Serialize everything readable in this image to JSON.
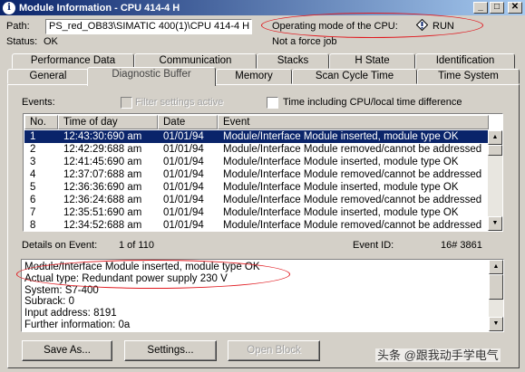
{
  "window": {
    "title": "Module Information - CPU 414-4 H",
    "minimize": "_",
    "maximize": "□",
    "close": "✕"
  },
  "header": {
    "path_label": "Path:",
    "path_value": "PS_red_OB83\\SIMATIC 400(1)\\CPU 414-4 H",
    "opmode_label": "Operating mode of the  CPU:",
    "opmode_value": "RUN",
    "status_label": "Status:",
    "status_value": "OK",
    "force_text": "Not a force job"
  },
  "tabs_row1": [
    "Performance Data",
    "Communication",
    "Stacks",
    "H State",
    "Identification"
  ],
  "tabs_row2": [
    "General",
    "Diagnostic Buffer",
    "Memory",
    "Scan Cycle Time",
    "Time System"
  ],
  "active_tab": "Diagnostic Buffer",
  "events": {
    "label": "Events:",
    "filter_label": "Filter settings active",
    "time_label": "Time including CPU/local time difference",
    "columns": [
      "No.",
      "Time of day",
      "Date",
      "Event"
    ],
    "rows": [
      {
        "no": "1",
        "time": "12:43:30:690 am",
        "date": "01/01/94",
        "event": "Module/Interface Module  inserted, module type OK"
      },
      {
        "no": "2",
        "time": "12:42:29:688 am",
        "date": "01/01/94",
        "event": "Module/Interface Module  removed/cannot be addressed"
      },
      {
        "no": "3",
        "time": "12:41:45:690 am",
        "date": "01/01/94",
        "event": "Module/Interface Module  inserted, module type OK"
      },
      {
        "no": "4",
        "time": "12:37:07:688 am",
        "date": "01/01/94",
        "event": "Module/Interface Module  removed/cannot be addressed"
      },
      {
        "no": "5",
        "time": "12:36:36:690 am",
        "date": "01/01/94",
        "event": "Module/Interface Module  inserted, module type OK"
      },
      {
        "no": "6",
        "time": "12:36:24:688 am",
        "date": "01/01/94",
        "event": "Module/Interface Module  removed/cannot be addressed"
      },
      {
        "no": "7",
        "time": "12:35:51:690 am",
        "date": "01/01/94",
        "event": "Module/Interface Module  inserted, module type OK"
      },
      {
        "no": "8",
        "time": "12:34:52:688 am",
        "date": "01/01/94",
        "event": "Module/Interface Module  removed/cannot be addressed"
      }
    ]
  },
  "details": {
    "label": "Details on Event:",
    "position": "1 of 110",
    "event_id_label": "Event ID:",
    "event_id_value": "16# 3861",
    "lines": [
      "Module/Interface Module  inserted, module type OK",
      "Actual type: Redundant power supply 230 V",
      "System: S7-400",
      "Subrack:    0",
      "Input address:  8191",
      "Further information: 0a"
    ]
  },
  "buttons": {
    "save_as": "Save As...",
    "settings": "Settings...",
    "open_block": "Open Block"
  },
  "watermark": "头条 @跟我动手学电气",
  "colors": {
    "title_bar": "#0a246a",
    "selection": "#0a246a",
    "highlight_oval": "#e0181e",
    "face": "#d4d0c8"
  }
}
